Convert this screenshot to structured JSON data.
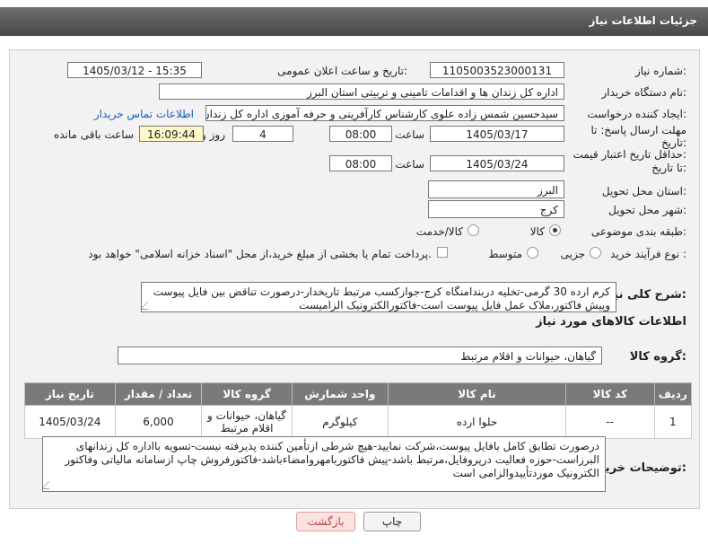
{
  "title": "جزئیات اطلاعات نیاز",
  "fields": {
    "need_number_label": "شماره نیاز:",
    "need_number": "1105003523000131",
    "announce_label": "تاریخ و ساعت اعلان عمومی:",
    "announce_value": "1405/03/12 - 15:35",
    "buyer_org_label": "نام دستگاه خریدار:",
    "buyer_org": "اداره کل زندان ها و اقدامات تامینی و تربیتی استان البرز",
    "requester_label": "ایجاد کننده درخواست:",
    "requester": "سیدحسین شمس زاده علوی کارشناس کارآفرینی و حرفه آموزی اداره کل زندان",
    "contact_link": "اطلاعات تماس خریدار",
    "deadline_label": "مهلت ارسال پاسخ: تا",
    "deadline_label2": "تاریخ:",
    "deadline_date": "1405/03/17",
    "time_label": "ساعت",
    "deadline_time": "08:00",
    "days_value": "4",
    "days_label": "روز و",
    "remaining_time": "16:09:44",
    "remaining_label": "ساعت باقی مانده",
    "validity_label": "حداقل تاریخ اعتبار قیمت:",
    "validity_label2": "تا تاریخ:",
    "validity_date": "1405/03/24",
    "validity_time_label": "ساعت",
    "validity_time": "08:00",
    "province_label": "استان محل تحویل:",
    "province": "البرز",
    "city_label": "شهر محل تحویل:",
    "city": "کرج",
    "category_label": "طبقه بندی موضوعی:",
    "category_goods": "کالا",
    "category_goods_service": "کالا/خدمت",
    "process_label": "نوع فرآیند خرید :",
    "process_minor": "جزیی",
    "process_medium": "متوسط",
    "payment_note": "پرداخت تمام یا بخشی از مبلغ خرید،از محل \"اسناد خزانه اسلامی\" خواهد بود.",
    "description_label": "شرح کلی نیاز:",
    "description": "کرم ارده 30 گرمی-تخلیه دربندامنگاه کرج-جوازکسب مرتبط تاریخدار-درصورت تناقض بین فایل پیوست وپیش فاکتور،ملاک عمل فایل پیوست است-فاکتورالکترونیک الزامیست",
    "goods_info_label": "اطلاعات کالاهای مورد نیاز",
    "goods_group_label": "گروه کالا:",
    "goods_group": "گیاهان، حیوانات و اقلام مرتبط",
    "buyer_notes_label": "توضیحات خریدار:",
    "buyer_notes": "درصورت تطابق کامل بافایل پیوست،شرکت نمایید-هیچ شرطی ازتأمین کننده پذیرفته نیست-تسویه بااداره کل زندانهای البرزاست-حوزه فعالیت درپروفایل،مرتبط باشد-پیش فاکتوربامهروامضاءباشد-فاکتورفروش چاپ ازسامانه مالیاتی وفاکتور الکترونیک موردتأییدوالزامی است"
  },
  "table": {
    "headers": [
      "ردیف",
      "کد کالا",
      "نام کالا",
      "واحد شمارش",
      "گروه کالا",
      "تعداد / مقدار",
      "تاریخ نیاز"
    ],
    "rows": [
      [
        "1",
        "--",
        "حلوا ارده",
        "کیلوگرم",
        "گیاهان، حیوانات و اقلام مرتبط",
        "6,000",
        "1405/03/24"
      ]
    ]
  },
  "buttons": {
    "print": "چاپ",
    "back": "بازگشت"
  }
}
